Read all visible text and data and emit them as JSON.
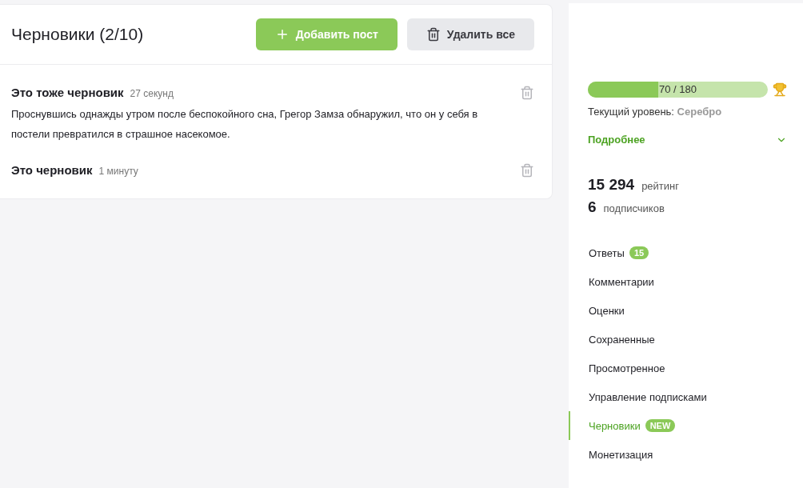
{
  "drafts": {
    "title": "Черновики (2/10)",
    "add_button": "Добавить пост",
    "delete_all_button": "Удалить все",
    "items": [
      {
        "title": "Это тоже черновик",
        "time": "27 секунд",
        "text": "Проснувшись однажды утром после беспокойного сна, Грегор Замза обнаружил, что он у себя в постели превратился в страшное насекомое."
      },
      {
        "title": "Это черновик",
        "time": "1 минуту"
      }
    ]
  },
  "profile": {
    "progress": {
      "level": 0.389,
      "reading": "70 / 180"
    },
    "level_label": "Текущий уровень:",
    "level_value": "Серебро",
    "details": {
      "label": "Подробнее",
      "expanded": false
    },
    "stats": [
      {
        "value": "15 294",
        "label": "рейтинг"
      },
      {
        "value": "6",
        "label": "подписчиков"
      }
    ],
    "nav": [
      {
        "label": "Ответы",
        "badge": "15",
        "selected": false
      },
      {
        "label": "Комментарии",
        "selected": false
      },
      {
        "label": "Оценки",
        "selected": false
      },
      {
        "label": "Сохраненные",
        "selected": false
      },
      {
        "label": "Просмотренное",
        "selected": false
      },
      {
        "label": "Управление подписками",
        "selected": false
      },
      {
        "label": "Черновики",
        "badge": "NEW",
        "selected": true
      },
      {
        "label": "Монетизация",
        "selected": false
      }
    ]
  }
}
